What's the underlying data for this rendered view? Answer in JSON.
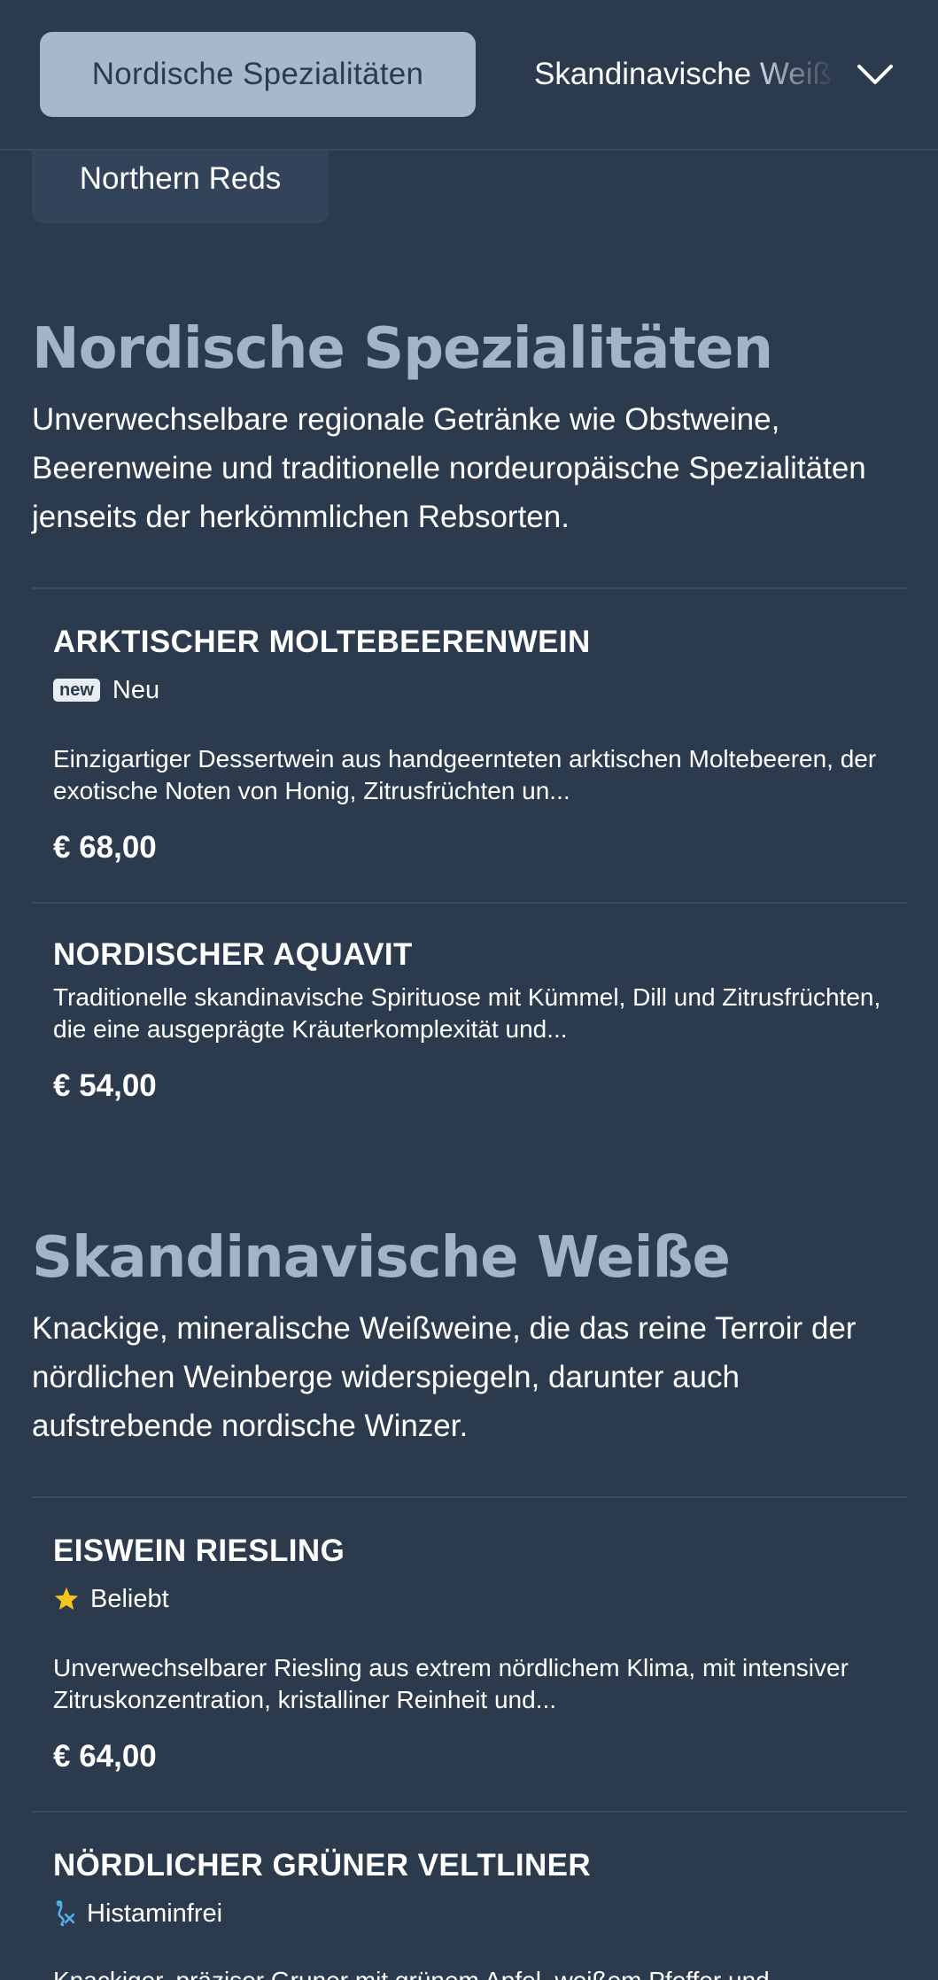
{
  "nav": {
    "active_tab": "Nordische Spezialitäten",
    "next_tab": "Skandinavische Weiße",
    "second_row_tab": "Northern Reds"
  },
  "sections": [
    {
      "title": "Nordische Spezialitäten",
      "description": "Unverwechselbare regionale Getränke wie Obstweine, Beerenweine und traditionelle nordeuropäische Spezialitäten jenseits der herkömmlichen Rebsorten.",
      "items": [
        {
          "name": "ARKTISCHER MOLTEBEERENWEIN",
          "badge_chip": "new",
          "badge_label": "Neu",
          "description": "Einzigartiger Dessertwein aus handgeernteten arktischen Moltebeeren, der exotische Noten von Honig, Zitrusfrüchten un...",
          "price": "€ 68,00"
        },
        {
          "name": "NORDISCHER AQUAVIT",
          "description": "Traditionelle skandinavische Spirituose mit Kümmel, Dill und Zitrusfrüchten, die eine ausgeprägte Kräuterkomplexität und...",
          "price": "€ 54,00"
        }
      ]
    },
    {
      "title": "Skandinavische Weiße",
      "description": "Knackige, mineralische Weißweine, die das reine Terroir der nördlichen Weinberge widerspiegeln, darunter auch aufstrebende nordische Winzer.",
      "items": [
        {
          "name": "EISWEIN RIESLING",
          "badge_icon": "star-icon",
          "badge_label": "Beliebt",
          "description": "Unverwechselbarer Riesling aus extrem nördlichem Klima, mit intensiver Zitruskonzentration, kristalliner Reinheit und...",
          "price": "€ 64,00"
        },
        {
          "name": "NÖRDLICHER GRÜNER VELTLINER",
          "badge_icon": "histamine-free-icon",
          "badge_label": "Histaminfrei",
          "description": "Knackiger, präziser Gruner mit grünem Apfel, weißem Pfeffer und"
        }
      ]
    }
  ],
  "colors": {
    "background": "#2c3a4e",
    "active_tab_bg": "#a8b8cc",
    "section_title": "#a3b4ca",
    "divider": "#3a4a5f",
    "star": "#f5c518",
    "histamine_icon": "#4fb3e8"
  }
}
